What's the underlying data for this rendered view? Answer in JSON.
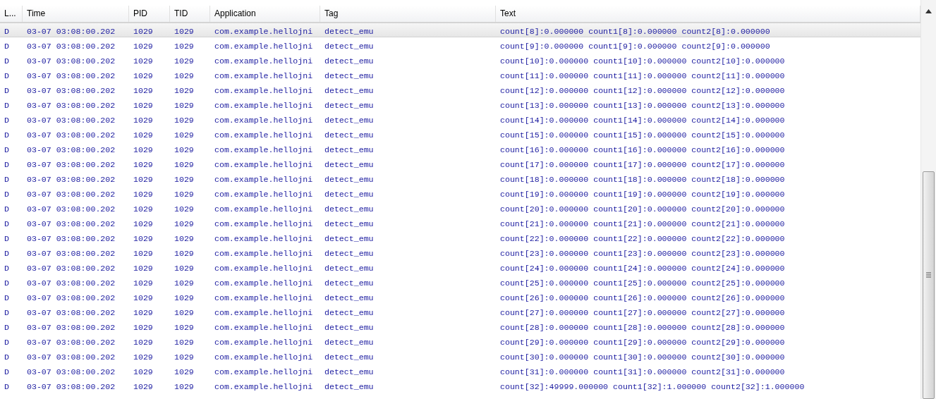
{
  "table": {
    "columns": [
      "L...",
      "Time",
      "PID",
      "TID",
      "Application",
      "Tag",
      "Text"
    ],
    "rows": [
      {
        "selected": true,
        "cells": [
          "D",
          "03-07 03:08:00.202",
          "1029",
          "1029",
          "com.example.hellojni",
          "detect_emu",
          "count[8]:0.000000 count1[8]:0.000000 count2[8]:0.000000"
        ]
      },
      {
        "selected": false,
        "cells": [
          "D",
          "03-07 03:08:00.202",
          "1029",
          "1029",
          "com.example.hellojni",
          "detect_emu",
          "count[9]:0.000000 count1[9]:0.000000 count2[9]:0.000000"
        ]
      },
      {
        "selected": false,
        "cells": [
          "D",
          "03-07 03:08:00.202",
          "1029",
          "1029",
          "com.example.hellojni",
          "detect_emu",
          "count[10]:0.000000 count1[10]:0.000000 count2[10]:0.000000"
        ]
      },
      {
        "selected": false,
        "cells": [
          "D",
          "03-07 03:08:00.202",
          "1029",
          "1029",
          "com.example.hellojni",
          "detect_emu",
          "count[11]:0.000000 count1[11]:0.000000 count2[11]:0.000000"
        ]
      },
      {
        "selected": false,
        "cells": [
          "D",
          "03-07 03:08:00.202",
          "1029",
          "1029",
          "com.example.hellojni",
          "detect_emu",
          "count[12]:0.000000 count1[12]:0.000000 count2[12]:0.000000"
        ]
      },
      {
        "selected": false,
        "cells": [
          "D",
          "03-07 03:08:00.202",
          "1029",
          "1029",
          "com.example.hellojni",
          "detect_emu",
          "count[13]:0.000000 count1[13]:0.000000 count2[13]:0.000000"
        ]
      },
      {
        "selected": false,
        "cells": [
          "D",
          "03-07 03:08:00.202",
          "1029",
          "1029",
          "com.example.hellojni",
          "detect_emu",
          "count[14]:0.000000 count1[14]:0.000000 count2[14]:0.000000"
        ]
      },
      {
        "selected": false,
        "cells": [
          "D",
          "03-07 03:08:00.202",
          "1029",
          "1029",
          "com.example.hellojni",
          "detect_emu",
          "count[15]:0.000000 count1[15]:0.000000 count2[15]:0.000000"
        ]
      },
      {
        "selected": false,
        "cells": [
          "D",
          "03-07 03:08:00.202",
          "1029",
          "1029",
          "com.example.hellojni",
          "detect_emu",
          "count[16]:0.000000 count1[16]:0.000000 count2[16]:0.000000"
        ]
      },
      {
        "selected": false,
        "cells": [
          "D",
          "03-07 03:08:00.202",
          "1029",
          "1029",
          "com.example.hellojni",
          "detect_emu",
          "count[17]:0.000000 count1[17]:0.000000 count2[17]:0.000000"
        ]
      },
      {
        "selected": false,
        "cells": [
          "D",
          "03-07 03:08:00.202",
          "1029",
          "1029",
          "com.example.hellojni",
          "detect_emu",
          "count[18]:0.000000 count1[18]:0.000000 count2[18]:0.000000"
        ]
      },
      {
        "selected": false,
        "cells": [
          "D",
          "03-07 03:08:00.202",
          "1029",
          "1029",
          "com.example.hellojni",
          "detect_emu",
          "count[19]:0.000000 count1[19]:0.000000 count2[19]:0.000000"
        ]
      },
      {
        "selected": false,
        "cells": [
          "D",
          "03-07 03:08:00.202",
          "1029",
          "1029",
          "com.example.hellojni",
          "detect_emu",
          "count[20]:0.000000 count1[20]:0.000000 count2[20]:0.000000"
        ]
      },
      {
        "selected": false,
        "cells": [
          "D",
          "03-07 03:08:00.202",
          "1029",
          "1029",
          "com.example.hellojni",
          "detect_emu",
          "count[21]:0.000000 count1[21]:0.000000 count2[21]:0.000000"
        ]
      },
      {
        "selected": false,
        "cells": [
          "D",
          "03-07 03:08:00.202",
          "1029",
          "1029",
          "com.example.hellojni",
          "detect_emu",
          "count[22]:0.000000 count1[22]:0.000000 count2[22]:0.000000"
        ]
      },
      {
        "selected": false,
        "cells": [
          "D",
          "03-07 03:08:00.202",
          "1029",
          "1029",
          "com.example.hellojni",
          "detect_emu",
          "count[23]:0.000000 count1[23]:0.000000 count2[23]:0.000000"
        ]
      },
      {
        "selected": false,
        "cells": [
          "D",
          "03-07 03:08:00.202",
          "1029",
          "1029",
          "com.example.hellojni",
          "detect_emu",
          "count[24]:0.000000 count1[24]:0.000000 count2[24]:0.000000"
        ]
      },
      {
        "selected": false,
        "cells": [
          "D",
          "03-07 03:08:00.202",
          "1029",
          "1029",
          "com.example.hellojni",
          "detect_emu",
          "count[25]:0.000000 count1[25]:0.000000 count2[25]:0.000000"
        ]
      },
      {
        "selected": false,
        "cells": [
          "D",
          "03-07 03:08:00.202",
          "1029",
          "1029",
          "com.example.hellojni",
          "detect_emu",
          "count[26]:0.000000 count1[26]:0.000000 count2[26]:0.000000"
        ]
      },
      {
        "selected": false,
        "cells": [
          "D",
          "03-07 03:08:00.202",
          "1029",
          "1029",
          "com.example.hellojni",
          "detect_emu",
          "count[27]:0.000000 count1[27]:0.000000 count2[27]:0.000000"
        ]
      },
      {
        "selected": false,
        "cells": [
          "D",
          "03-07 03:08:00.202",
          "1029",
          "1029",
          "com.example.hellojni",
          "detect_emu",
          "count[28]:0.000000 count1[28]:0.000000 count2[28]:0.000000"
        ]
      },
      {
        "selected": false,
        "cells": [
          "D",
          "03-07 03:08:00.202",
          "1029",
          "1029",
          "com.example.hellojni",
          "detect_emu",
          "count[29]:0.000000 count1[29]:0.000000 count2[29]:0.000000"
        ]
      },
      {
        "selected": false,
        "cells": [
          "D",
          "03-07 03:08:00.202",
          "1029",
          "1029",
          "com.example.hellojni",
          "detect_emu",
          "count[30]:0.000000 count1[30]:0.000000 count2[30]:0.000000"
        ]
      },
      {
        "selected": false,
        "cells": [
          "D",
          "03-07 03:08:00.202",
          "1029",
          "1029",
          "com.example.hellojni",
          "detect_emu",
          "count[31]:0.000000 count1[31]:0.000000 count2[31]:0.000000"
        ]
      },
      {
        "selected": false,
        "cells": [
          "D",
          "03-07 03:08:00.202",
          "1029",
          "1029",
          "com.example.hellojni",
          "detect_emu",
          "count[32]:49999.000000 count1[32]:1.000000 count2[32]:1.000000"
        ]
      }
    ]
  }
}
